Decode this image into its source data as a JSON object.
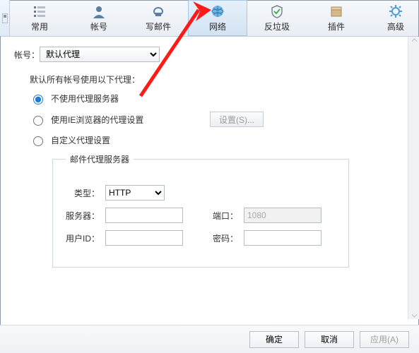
{
  "toolbar": {
    "items": [
      {
        "label": "常用",
        "icon": "common"
      },
      {
        "label": "帐号",
        "icon": "account"
      },
      {
        "label": "写邮件",
        "icon": "compose"
      },
      {
        "label": "网络",
        "icon": "network",
        "active": true
      },
      {
        "label": "反垃圾",
        "icon": "antispam"
      },
      {
        "label": "插件",
        "icon": "plugin"
      },
      {
        "label": "高级",
        "icon": "advanced"
      }
    ]
  },
  "account": {
    "label": "帐号：",
    "value": "默认代理"
  },
  "proxy": {
    "desc": "默认所有帐号使用以下代理：",
    "options": [
      {
        "label": "不使用代理服务器",
        "selected": true
      },
      {
        "label": "使用IE浏览器的代理设置",
        "selected": false
      },
      {
        "label": "自定义代理设置",
        "selected": false
      }
    ],
    "settings_btn": "设置(S)...",
    "group_title": "邮件代理服务器",
    "fields": {
      "type_label": "类型：",
      "type_value": "HTTP",
      "server_label": "服务器：",
      "server_value": "",
      "port_label": "端口：",
      "port_value": "1080",
      "user_label": "用户ID：",
      "user_value": "",
      "pass_label": "密码：",
      "pass_value": ""
    }
  },
  "footer": {
    "ok": "确定",
    "cancel": "取消",
    "apply": "应用(A)"
  }
}
